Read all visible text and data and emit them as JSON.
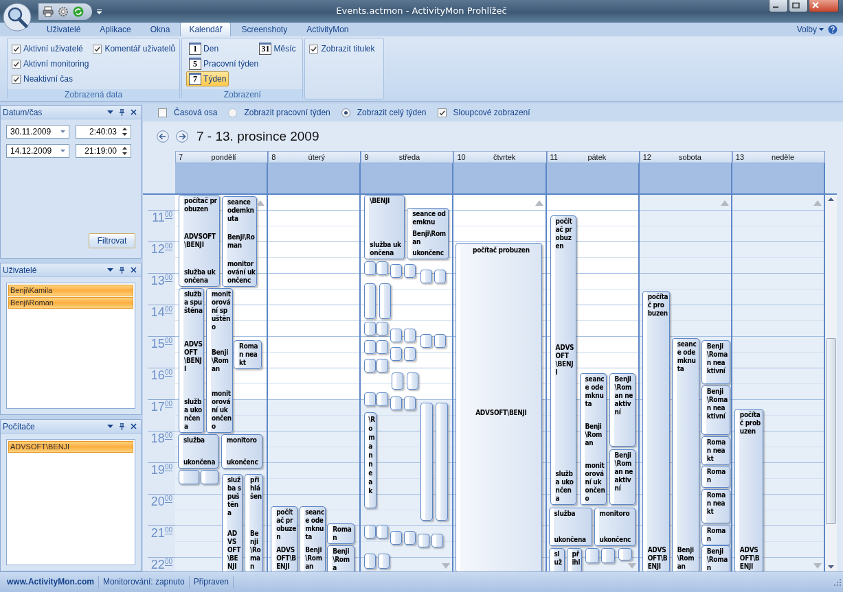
{
  "window": {
    "title": "Events.actmon - ActivityMon Prohlížeč"
  },
  "ribbon": {
    "tabs": [
      {
        "label": "Uživatelé",
        "selected": false
      },
      {
        "label": "Aplikace",
        "selected": false
      },
      {
        "label": "Okna",
        "selected": false
      },
      {
        "label": "Kalendář",
        "selected": true
      },
      {
        "label": "Screenshoty",
        "selected": false
      },
      {
        "label": "ActivityMon",
        "selected": false
      }
    ],
    "options_menu": "Volby",
    "groups": [
      {
        "label": "Zobrazená data",
        "kind": "checks",
        "items": [
          {
            "label": "Aktivní uživatelé",
            "checked": true
          },
          {
            "label": "Komentář uživatelů",
            "checked": true
          },
          {
            "label": "Aktivní monitoring",
            "checked": true
          },
          {
            "label": "Neaktivní čas",
            "checked": true
          }
        ]
      },
      {
        "label": "Zobrazení",
        "kind": "views",
        "items": [
          {
            "icon_text": "1",
            "label": "Den",
            "selected": false
          },
          {
            "icon_text": "31",
            "label": "Měsíc",
            "selected": false
          },
          {
            "icon_text": "5",
            "label": "Pracovní týden",
            "selected": false
          },
          {
            "icon_text": "7",
            "label": "Týden",
            "selected": true
          }
        ]
      },
      {
        "kind": "checks",
        "items": [
          {
            "label": "Zobrazit titulek",
            "checked": true
          }
        ]
      }
    ]
  },
  "sidebar": {
    "panels": [
      {
        "title": "Datum/čas",
        "kind": "datetime",
        "rows": [
          {
            "date": "30.11.2009",
            "time": "2:40:03"
          },
          {
            "date": "14.12.2009",
            "time": "21:19:00"
          }
        ],
        "button": "Filtrovat"
      },
      {
        "title": "Uživatelé",
        "kind": "list",
        "items": [
          {
            "label": "Benji\\Kamila",
            "selected": true
          },
          {
            "label": "Benji\\Roman",
            "selected": true
          }
        ]
      },
      {
        "title": "Počítače",
        "kind": "list",
        "items": [
          {
            "label": "ADVSOFT\\BENJI",
            "selected": true
          }
        ]
      }
    ]
  },
  "options": [
    {
      "kind": "checkbox",
      "label": "Časová osa",
      "checked": false
    },
    {
      "kind": "radio",
      "label": "Zobrazit pracovní týden",
      "selected": false
    },
    {
      "kind": "radio",
      "label": "Zobrazit celý týden",
      "selected": true
    },
    {
      "kind": "checkbox",
      "label": "Sloupcové zobrazení",
      "checked": true
    }
  ],
  "calendar": {
    "range_title": "7 - 13. prosince 2009",
    "hours": [
      {
        "hour": "11",
        "minutes": "00"
      },
      {
        "hour": "12",
        "minutes": "00"
      },
      {
        "hour": "13",
        "minutes": "00"
      },
      {
        "hour": "14",
        "minutes": "00"
      },
      {
        "hour": "15",
        "minutes": "00"
      },
      {
        "hour": "16",
        "minutes": "00"
      },
      {
        "hour": "17",
        "minutes": "00"
      },
      {
        "hour": "18",
        "minutes": "00"
      },
      {
        "hour": "19",
        "minutes": "00"
      },
      {
        "hour": "20",
        "minutes": "00"
      },
      {
        "hour": "21",
        "minutes": "00"
      },
      {
        "hour": "22",
        "minutes": "00"
      }
    ],
    "days": [
      {
        "number": "7",
        "name": "pondělí",
        "workday": true,
        "more_above": true,
        "more_below": false,
        "events": [
          {
            "kind": "item",
            "lines": [
              "počítač probuzen",
              "ADVSOFT\\BENJI",
              "služba ukončena"
            ]
          },
          {
            "kind": "item",
            "lines": [
              "seance odemknuta",
              "Benji\\Roman",
              "monitorování ukončenc"
            ]
          },
          {
            "kind": "item",
            "lines": [
              "služba spuštěna",
              "ADVSOFT\\BENJI",
              "služba ukončena"
            ]
          },
          {
            "kind": "item",
            "lines": [
              "monitorování spuštěno",
              "Benji\\Roman",
              "monitorování ukončeno"
            ]
          },
          {
            "kind": "item",
            "lines": [
              "Roman neakt"
            ]
          },
          {
            "kind": "item",
            "lines": [
              "služba",
              "ukončena"
            ]
          },
          {
            "kind": "item",
            "lines": [
              "monitoro",
              "ukončenc"
            ]
          },
          {
            "kind": "chip"
          },
          {
            "kind": "chip"
          },
          {
            "kind": "item",
            "lines": [
              "služba spuštěna",
              "ADVSOFT\\BENJI"
            ]
          },
          {
            "kind": "item",
            "lines": [
              "přihlášen",
              "Benji\\Roman"
            ]
          }
        ]
      },
      {
        "number": "8",
        "name": "úterý",
        "workday": true,
        "more_above": false,
        "more_below": false,
        "events": [
          {
            "kind": "item",
            "lines": [
              "počítač probuzen",
              "ADVSOFT\\BENJI"
            ]
          },
          {
            "kind": "item",
            "lines": [
              "seance odemknuta",
              "Benji\\Roman"
            ]
          },
          {
            "kind": "item",
            "lines": [
              "Roman"
            ]
          },
          {
            "kind": "item",
            "lines": [
              "Benji\\Roma"
            ]
          }
        ]
      },
      {
        "number": "9",
        "name": "středa",
        "workday": true,
        "more_above": false,
        "more_below": true,
        "events": [
          {
            "kind": "item",
            "lines": [
              "\\BENJI",
              "služba ukončena"
            ]
          },
          {
            "kind": "item",
            "lines": [
              "seance odemknu",
              "Benji\\Roman",
              "ukončenc"
            ]
          },
          {
            "kind": "chip"
          },
          {
            "kind": "chip"
          },
          {
            "kind": "chip"
          },
          {
            "kind": "chip"
          },
          {
            "kind": "chip"
          },
          {
            "kind": "chip"
          },
          {
            "kind": "chip"
          },
          {
            "kind": "chip"
          },
          {
            "kind": "chip"
          },
          {
            "kind": "chip"
          },
          {
            "kind": "chip"
          },
          {
            "kind": "chip"
          },
          {
            "kind": "chip"
          },
          {
            "kind": "chip"
          },
          {
            "kind": "chip"
          },
          {
            "kind": "chip"
          },
          {
            "kind": "chip"
          },
          {
            "kind": "chip"
          },
          {
            "kind": "chip"
          },
          {
            "kind": "chip"
          },
          {
            "kind": "chip"
          },
          {
            "kind": "chip"
          },
          {
            "kind": "chip"
          },
          {
            "kind": "chip"
          },
          {
            "kind": "chip"
          },
          {
            "kind": "chip"
          },
          {
            "kind": "vertical",
            "lines": [
              "\\Romanneak"
            ]
          },
          {
            "kind": "chip"
          },
          {
            "kind": "chip"
          },
          {
            "kind": "chip"
          },
          {
            "kind": "chip"
          },
          {
            "kind": "chip"
          },
          {
            "kind": "chip"
          },
          {
            "kind": "chip"
          },
          {
            "kind": "chip"
          },
          {
            "kind": "chip"
          },
          {
            "kind": "chip"
          }
        ]
      },
      {
        "number": "10",
        "name": "čtvrtek",
        "workday": true,
        "more_above": true,
        "more_below": false,
        "events": [
          {
            "kind": "wide",
            "lines": [
              "počítač probuzen",
              "ADVSOFT\\BENJI"
            ]
          }
        ]
      },
      {
        "number": "11",
        "name": "pátek",
        "workday": true,
        "more_above": false,
        "more_below": true,
        "events": [
          {
            "kind": "item",
            "lines": [
              "počítač probuzen",
              "ADVSOFT\\BENJI",
              "služba ukončena"
            ]
          },
          {
            "kind": "item",
            "lines": [
              "seance odemknuta",
              "Benji\\Roman",
              "monitorování ukončeno"
            ]
          },
          {
            "kind": "item",
            "lines": [
              "Benji\\Roman neaktivní"
            ]
          },
          {
            "kind": "item",
            "lines": [
              "Benji\\Roman neaktivní"
            ]
          },
          {
            "kind": "item",
            "lines": [
              "služba",
              "ukončena"
            ]
          },
          {
            "kind": "item",
            "lines": [
              "monitoro",
              "ukončenc"
            ]
          },
          {
            "kind": "item",
            "lines": [
              "služ"
            ]
          },
          {
            "kind": "item",
            "lines": [
              "přihl"
            ]
          },
          {
            "kind": "chip"
          },
          {
            "kind": "chip"
          },
          {
            "kind": "chip"
          }
        ]
      },
      {
        "number": "12",
        "name": "sobota",
        "workday": false,
        "more_above": true,
        "more_below": false,
        "events": [
          {
            "kind": "item",
            "lines": [
              "počítač probuzen",
              "ADVSOFT\\BENJI"
            ]
          },
          {
            "kind": "item",
            "lines": [
              "seance odemknuta",
              "Benji\\Roman"
            ]
          },
          {
            "kind": "item",
            "lines": [
              "Benji\\Roman neaktivní"
            ]
          },
          {
            "kind": "item",
            "lines": [
              "Benji\\Roman neaktivní"
            ]
          },
          {
            "kind": "item",
            "lines": [
              "Roman neakt"
            ]
          },
          {
            "kind": "item",
            "lines": [
              "Roman"
            ]
          },
          {
            "kind": "item",
            "lines": [
              "Roman neakt"
            ]
          },
          {
            "kind": "item",
            "lines": [
              "Roman"
            ]
          },
          {
            "kind": "item",
            "lines": [
              "Benji\\Roman"
            ]
          }
        ]
      },
      {
        "number": "13",
        "name": "neděle",
        "workday": false,
        "more_above": true,
        "more_below": true,
        "events": [
          {
            "kind": "item",
            "lines": [
              "počítač probuzen",
              "ADVSOFT\\BENJI"
            ]
          }
        ]
      }
    ]
  },
  "status_bar": {
    "website": "www.ActivityMon.com",
    "monitoring": "Monitorování: zapnuto",
    "state": "Připraven"
  }
}
